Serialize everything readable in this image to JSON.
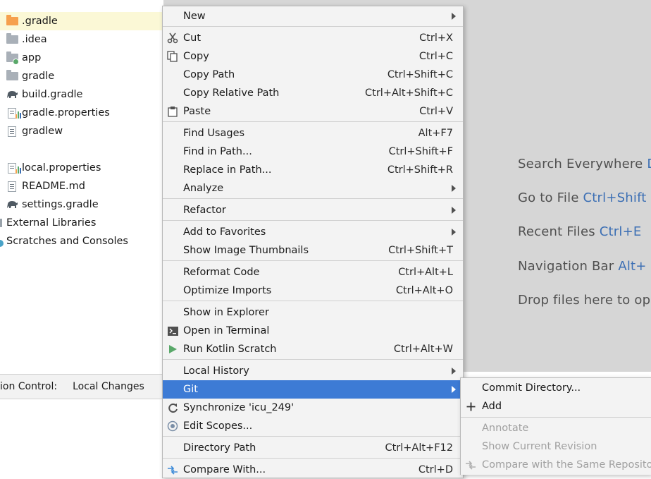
{
  "tree": {
    "items": [
      {
        "label": ".gradle",
        "icon": "folder-orange-icon",
        "selected": true
      },
      {
        "label": ".idea",
        "icon": "folder-icon"
      },
      {
        "label": "app",
        "icon": "module-folder-icon"
      },
      {
        "label": "gradle",
        "icon": "folder-icon"
      },
      {
        "label": "build.gradle",
        "icon": "gradle-elephant-icon"
      },
      {
        "label": "gradle.properties",
        "icon": "properties-file-icon"
      },
      {
        "label": "gradlew",
        "icon": "text-file-icon"
      },
      {
        "label": "local.properties",
        "icon": "properties-file-icon"
      },
      {
        "label": "README.md",
        "icon": "text-file-icon"
      },
      {
        "label": "settings.gradle",
        "icon": "gradle-elephant-icon"
      },
      {
        "label": "External Libraries",
        "icon": "libraries-icon"
      },
      {
        "label": "Scratches and Consoles",
        "icon": "scratches-icon"
      }
    ]
  },
  "bottom_bar": {
    "vcs_label": "ion Control:",
    "local_changes_label": "Local Changes"
  },
  "editor_hints": [
    {
      "text": "Search Everywhere ",
      "key": "D"
    },
    {
      "text": "Go to File ",
      "key": "Ctrl+Shift"
    },
    {
      "text": "Recent Files ",
      "key": "Ctrl+E"
    },
    {
      "text": "Navigation Bar ",
      "key": "Alt+"
    },
    {
      "text": "Drop files here to op",
      "key": ""
    }
  ],
  "menu": {
    "items": [
      {
        "label": "New",
        "shortcut": "",
        "submenu": true,
        "icon": ""
      },
      {
        "label": "Cut",
        "shortcut": "Ctrl+X",
        "icon": "scissors-icon"
      },
      {
        "label": "Copy",
        "shortcut": "Ctrl+C",
        "icon": "copy-icon"
      },
      {
        "label": "Copy Path",
        "shortcut": "Ctrl+Shift+C",
        "icon": ""
      },
      {
        "label": "Copy Relative Path",
        "shortcut": "Ctrl+Alt+Shift+C",
        "icon": ""
      },
      {
        "label": "Paste",
        "shortcut": "Ctrl+V",
        "icon": "clipboard-icon"
      },
      {
        "label": "Find Usages",
        "shortcut": "Alt+F7",
        "icon": ""
      },
      {
        "label": "Find in Path...",
        "shortcut": "Ctrl+Shift+F",
        "icon": ""
      },
      {
        "label": "Replace in Path...",
        "shortcut": "Ctrl+Shift+R",
        "icon": ""
      },
      {
        "label": "Analyze",
        "shortcut": "",
        "submenu": true,
        "icon": ""
      },
      {
        "label": "Refactor",
        "shortcut": "",
        "submenu": true,
        "icon": ""
      },
      {
        "label": "Add to Favorites",
        "shortcut": "",
        "submenu": true,
        "icon": ""
      },
      {
        "label": "Show Image Thumbnails",
        "shortcut": "Ctrl+Shift+T",
        "icon": ""
      },
      {
        "label": "Reformat Code",
        "shortcut": "Ctrl+Alt+L",
        "icon": ""
      },
      {
        "label": "Optimize Imports",
        "shortcut": "Ctrl+Alt+O",
        "icon": ""
      },
      {
        "label": "Show in Explorer",
        "shortcut": "",
        "icon": ""
      },
      {
        "label": "Open in Terminal",
        "shortcut": "",
        "icon": "terminal-icon"
      },
      {
        "label": "Run Kotlin Scratch",
        "shortcut": "Ctrl+Alt+W",
        "icon": "run-icon"
      },
      {
        "label": "Local History",
        "shortcut": "",
        "submenu": true,
        "icon": ""
      },
      {
        "label": "Git",
        "shortcut": "",
        "submenu": true,
        "highlighted": true,
        "icon": ""
      },
      {
        "label": "Synchronize 'icu_249'",
        "shortcut": "",
        "icon": "sync-icon"
      },
      {
        "label": "Edit Scopes...",
        "shortcut": "",
        "icon": "scope-icon"
      },
      {
        "label": "Directory Path",
        "shortcut": "Ctrl+Alt+F12",
        "icon": ""
      },
      {
        "label": "Compare With...",
        "shortcut": "Ctrl+D",
        "icon": "compare-icon"
      }
    ]
  },
  "git_submenu": {
    "items": [
      {
        "label": "Commit Directory...",
        "enabled": true,
        "icon": ""
      },
      {
        "label": "Add",
        "enabled": true,
        "icon": "plus-icon"
      },
      {
        "label": "Annotate",
        "enabled": false,
        "icon": ""
      },
      {
        "label": "Show Current Revision",
        "enabled": false,
        "icon": ""
      },
      {
        "label": "Compare with the Same Reposito",
        "enabled": false,
        "icon": "compare-icon"
      }
    ]
  },
  "colors": {
    "highlight": "#3d7bd5",
    "hint_key": "#3c6fb4",
    "selected_row": "#fbf8d6"
  }
}
